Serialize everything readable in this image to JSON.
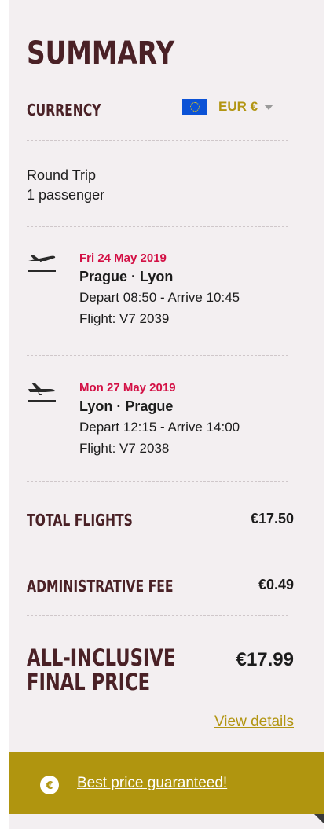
{
  "summary": {
    "title": "SUMMARY",
    "currency_label": "CURRENCY",
    "currency_value": "EUR €",
    "currency_flag": "eu-flag-icon"
  },
  "trip": {
    "type": "Round Trip",
    "passengers": "1 passenger"
  },
  "flights": [
    {
      "icon": "plane-takeoff-icon",
      "date": "Fri 24 May 2019",
      "route": "Prague · Lyon",
      "times": "Depart 08:50 - Arrive 10:45",
      "number": "Flight: V7 2039"
    },
    {
      "icon": "plane-landing-icon",
      "date": "Mon 27 May 2019",
      "route": "Lyon · Prague",
      "times": "Depart 12:15 - Arrive 14:00",
      "number": "Flight: V7 2038"
    }
  ],
  "totals": {
    "flights_label": "TOTAL FLIGHTS",
    "flights_value": "€17.50",
    "fee_label": "ADMINISTRATIVE FEE",
    "fee_value": "€0.49",
    "final_label_line1": "ALL-INCLUSIVE",
    "final_label_line2": "FINAL PRICE",
    "final_value": "€17.99",
    "view_details": "View details"
  },
  "banner": {
    "icon": "euro-badge-icon",
    "link": "Best price guaranteed!"
  },
  "colors": {
    "title": "#4a2126",
    "accent_gold": "#b29512",
    "date_red": "#d31045",
    "panel_bg": "#f3eff1"
  }
}
